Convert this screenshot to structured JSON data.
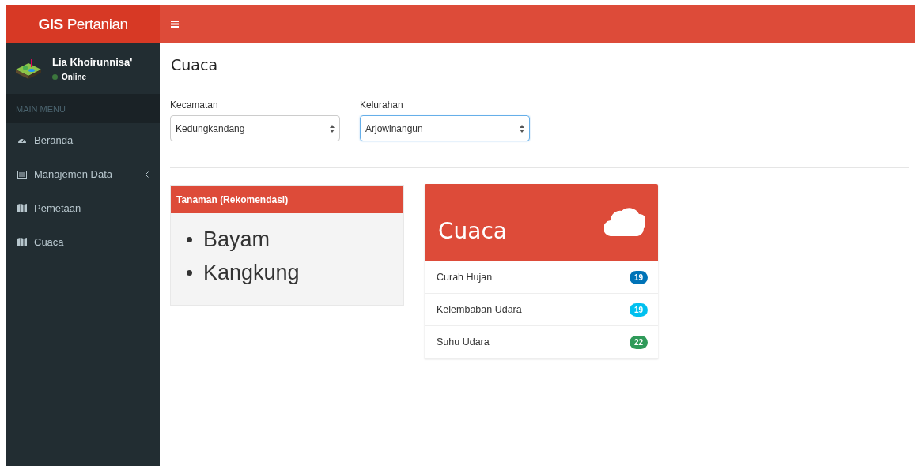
{
  "brand": {
    "bold": "GIS",
    "light": "Pertanian"
  },
  "user": {
    "name": "Lia Khoirunnisa'",
    "status": "Online",
    "online": true
  },
  "sidebar": {
    "header": "MAIN MENU",
    "items": [
      {
        "label": "Beranda",
        "kind": "dashboard",
        "has_children": false
      },
      {
        "label": "Manajemen Data",
        "kind": "list",
        "has_children": true
      },
      {
        "label": "Pemetaan",
        "kind": "map",
        "has_children": false
      },
      {
        "label": "Cuaca",
        "kind": "map",
        "has_children": false
      }
    ]
  },
  "page": {
    "title": "Cuaca"
  },
  "filters": [
    {
      "label": "Kecamatan",
      "value": "Kedungkandang",
      "focused": false
    },
    {
      "label": "Kelurahan",
      "value": "Arjowinangun",
      "focused": true
    }
  ],
  "recommendation": {
    "title": "Tanaman (Rekomendasi)",
    "items": [
      "Bayam",
      "Kangkung"
    ]
  },
  "weather": {
    "title": "Cuaca",
    "items": [
      {
        "label": "Curah Hujan",
        "value": "19",
        "color": "#0073b7"
      },
      {
        "label": "Kelembaban Udara",
        "value": "19",
        "color": "#00c0ef"
      },
      {
        "label": "Suhu Udara",
        "value": "22",
        "color": "#2f9a59"
      }
    ]
  }
}
